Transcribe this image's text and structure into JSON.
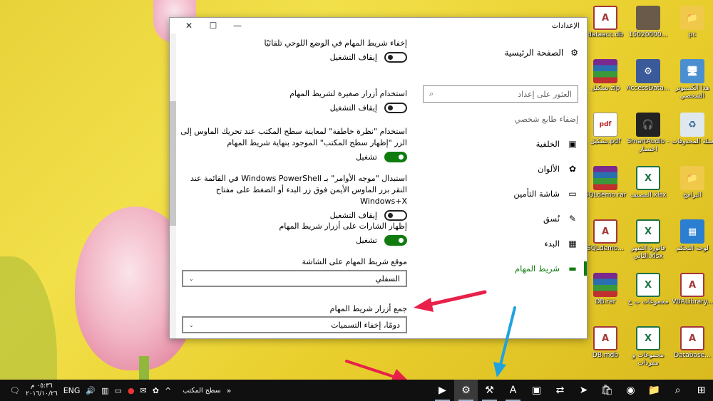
{
  "window": {
    "title": "الإعدادات",
    "controls": {
      "close": "✕",
      "maximize": "☐",
      "minimize": "—"
    }
  },
  "nav": {
    "home": "الصفحة الرئيسية",
    "search_placeholder": "العثور على إعداد",
    "section": "إضفاء طابع شخصي",
    "items": [
      {
        "label": "الخلفية",
        "icon": "picture-icon"
      },
      {
        "label": "الألوان",
        "icon": "palette-icon"
      },
      {
        "label": "شاشة التأمين",
        "icon": "lock-screen-icon"
      },
      {
        "label": "نُسق",
        "icon": "brush-icon"
      },
      {
        "label": "البدء",
        "icon": "start-icon"
      },
      {
        "label": "شريط المهام",
        "icon": "taskbar-icon",
        "active": true
      }
    ]
  },
  "settings": {
    "s1": {
      "text": "إخفاء شريط المهام في الوضع اللوحي تلقائيًا",
      "state": "إيقاف التشغيل",
      "on": false
    },
    "s2": {
      "text": "استخدام أزرار صغيرة لشريط المهام",
      "state": "إيقاف التشغيل",
      "on": false
    },
    "s3": {
      "text": "استخدام \"نظرة خاطفة\" لمعاينة سطح المكتب عند تحريك الماوس إلى الزر \"إظهار سطح المكتب\" الموجود بنهاية شريط المهام",
      "state": "تشغيل",
      "on": true
    },
    "s4": {
      "text": "استبدال \"موجه الأوامر\" بـ Windows PowerShell في القائمة عند النقر بزر الماوس الأيمن فوق زر البدء أو الضغط على مفتاح Windows+X",
      "state": "إيقاف التشغيل",
      "on": false
    },
    "s5": {
      "text": "إظهار الشارات على أزرار شريط المهام",
      "state": "تشغيل",
      "on": true
    },
    "location_label": "موقع شريط المهام على الشاشة",
    "location_value": "السفلي",
    "combine_label": "جمع أزرار شريط المهام",
    "combine_value": "دومًا، إخفاء التسميات"
  },
  "desktop": {
    "icons": [
      {
        "label": "pc",
        "type": "folder",
        "glyph": "📁"
      },
      {
        "label": "15020000...",
        "type": "photo",
        "glyph": ""
      },
      {
        "label": "dataacc.db",
        "type": "access",
        "glyph": "A"
      },
      {
        "label": "هذا الكمبيوتر الشخصي",
        "type": "pc",
        "glyph": "🖥"
      },
      {
        "label": "AccessData...",
        "type": "setup",
        "glyph": "⚙"
      },
      {
        "label": "تشكيل.zip",
        "type": "rar",
        "glyph": ""
      },
      {
        "label": "سلة المحذوفات",
        "type": "recycle",
        "glyph": "♻"
      },
      {
        "label": "SmartAudio - اختصار",
        "type": "audio",
        "glyph": "🎧"
      },
      {
        "label": "تشكيل.pdf",
        "type": "pdf",
        "glyph": "pdf"
      },
      {
        "label": "البرامج",
        "type": "folder",
        "glyph": "📁"
      },
      {
        "label": "المصنف.xlsx",
        "type": "excel",
        "glyph": "X"
      },
      {
        "label": "SQLdemo.rar",
        "type": "rar",
        "glyph": ""
      },
      {
        "label": "لوحة التحكم",
        "type": "cpanel",
        "glyph": "▦"
      },
      {
        "label": "فاتورة الشهر الثاني.xlsx",
        "type": "excel",
        "glyph": "X"
      },
      {
        "label": "SQLdemo...",
        "type": "access",
        "glyph": "A"
      },
      {
        "label": "VBALibrary...",
        "type": "access",
        "glyph": "A"
      },
      {
        "label": "مجموعات ب ج",
        "type": "excel",
        "glyph": "X"
      },
      {
        "label": "DB.rar",
        "type": "rar",
        "glyph": ""
      },
      {
        "label": "Database...",
        "type": "access",
        "glyph": "A"
      },
      {
        "label": "مجموعات و مفردات",
        "type": "excel",
        "glyph": "X"
      },
      {
        "label": "DB.mdb",
        "type": "access",
        "glyph": "A"
      }
    ]
  },
  "taskbar": {
    "desktop_label": "سطح المكتب",
    "chevron": "»",
    "lang": "ENG",
    "time": "٠٥:٣٦ م",
    "date": "٢٠١٦/١٠/٢٦",
    "apps": [
      {
        "name": "start-button",
        "glyph": "⊞"
      },
      {
        "name": "search-button",
        "glyph": "⌕"
      },
      {
        "name": "file-explorer-button",
        "glyph": "📁"
      },
      {
        "name": "chrome-button",
        "glyph": "◉"
      },
      {
        "name": "store-button",
        "glyph": "🛍"
      },
      {
        "name": "telegram-button",
        "glyph": "➤"
      },
      {
        "name": "teamviewer-button",
        "glyph": "⇄"
      },
      {
        "name": "network-app-button",
        "glyph": "▣"
      },
      {
        "name": "access-button",
        "glyph": "A"
      },
      {
        "name": "tools-button",
        "glyph": "⚒"
      },
      {
        "name": "settings-button",
        "glyph": "⚙"
      },
      {
        "name": "green-app-button",
        "glyph": "▶"
      }
    ],
    "colors": {
      "accent": "#107c10",
      "red_arrow": "#e8204a",
      "blue_arrow": "#1fa3e0"
    }
  }
}
